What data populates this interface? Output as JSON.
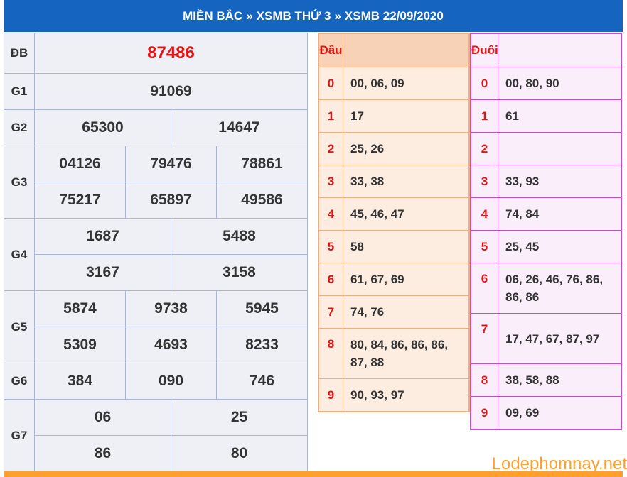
{
  "header": {
    "crumb1": "MIỀN BẮC",
    "crumb2": "XSMB THỨ 3",
    "crumb3": "XSMB 22/09/2020",
    "sep": "»"
  },
  "results": {
    "db_label": "ĐB",
    "db": "87486",
    "g1_label": "G1",
    "g1": "91069",
    "g2_label": "G2",
    "g2": [
      "65300",
      "14647"
    ],
    "g3_label": "G3",
    "g3": [
      "04126",
      "79476",
      "78861",
      "75217",
      "65897",
      "49586"
    ],
    "g4_label": "G4",
    "g4": [
      "1687",
      "5488",
      "3167",
      "3158"
    ],
    "g5_label": "G5",
    "g5": [
      "5874",
      "9738",
      "5945",
      "5309",
      "4693",
      "8233"
    ],
    "g6_label": "G6",
    "g6": [
      "384",
      "090",
      "746"
    ],
    "g7_label": "G7",
    "g7": [
      "06",
      "25",
      "86",
      "80"
    ]
  },
  "dau": {
    "title": "Đầu",
    "rows": [
      {
        "d": "0",
        "v": "00, 06, 09"
      },
      {
        "d": "1",
        "v": "17"
      },
      {
        "d": "2",
        "v": "25, 26"
      },
      {
        "d": "3",
        "v": "33, 38"
      },
      {
        "d": "4",
        "v": "45, 46, 47"
      },
      {
        "d": "5",
        "v": "58"
      },
      {
        "d": "6",
        "v": "61, 67, 69"
      },
      {
        "d": "7",
        "v": "74, 76"
      },
      {
        "d": "8",
        "v": "80, 84, 86, 86, 86, 87, 88"
      },
      {
        "d": "9",
        "v": "90, 93, 97"
      }
    ]
  },
  "duoi": {
    "title": "Đuôi",
    "rows": [
      {
        "d": "0",
        "v": "00, 80, 90"
      },
      {
        "d": "1",
        "v": "61"
      },
      {
        "d": "2",
        "v": ""
      },
      {
        "d": "3",
        "v": "33, 93"
      },
      {
        "d": "4",
        "v": "74, 84"
      },
      {
        "d": "5",
        "v": "25, 45"
      },
      {
        "d": "6",
        "v": "06, 26, 46, 76, 86, 86, 86"
      },
      {
        "d": "7",
        "v": "17, 47, 67, 87, 97"
      },
      {
        "d": "8",
        "v": "38, 58, 88"
      },
      {
        "d": "9",
        "v": "09, 69"
      }
    ]
  },
  "watermark": "Lodephomnay.net",
  "colors": {
    "header": "#1565c0",
    "special": "#e31414",
    "accent": "#ff9f2e"
  }
}
